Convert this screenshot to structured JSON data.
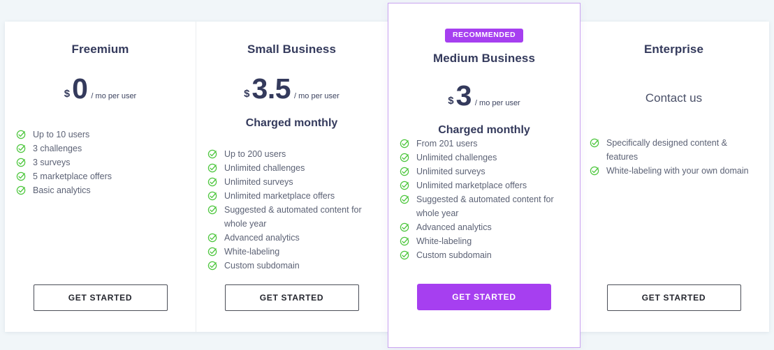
{
  "plans": [
    {
      "name": "Freemium",
      "currency": "$",
      "amount": "0",
      "period": "/ mo per user",
      "billing_note": "",
      "contact_label": "",
      "features": [
        "Up to 10 users",
        "3 challenges",
        "3 surveys",
        "5 marketplace offers",
        "Basic analytics"
      ],
      "cta_label": "GET STARTED"
    },
    {
      "name": "Small Business",
      "currency": "$",
      "amount": "3.5",
      "period": "/ mo per user",
      "billing_note": "Charged monthly",
      "contact_label": "",
      "features": [
        "Up to 200 users",
        "Unlimited challenges",
        "Unlimited surveys",
        "Unlimited marketplace offers",
        "Suggested & automated content for whole year",
        "Advanced analytics",
        "White-labeling",
        "Custom subdomain"
      ],
      "cta_label": "GET STARTED"
    },
    {
      "name": "Medium Business",
      "badge": "RECOMMENDED",
      "currency": "$",
      "amount": "3",
      "period": "/ mo per user",
      "billing_note": "Charged monthly",
      "contact_label": "",
      "features": [
        "From 201 users",
        "Unlimited challenges",
        "Unlimited surveys",
        "Unlimited marketplace offers",
        "Suggested & automated content for whole year",
        "Advanced analytics",
        "White-labeling",
        "Custom subdomain"
      ],
      "cta_label": "GET STARTED"
    },
    {
      "name": "Enterprise",
      "currency": "",
      "amount": "",
      "period": "",
      "billing_note": "",
      "contact_label": "Contact us",
      "features": [
        "Specifically designed content & features",
        "White-labeling with your own domain"
      ],
      "cta_label": "GET STARTED"
    }
  ],
  "icons": {
    "feature_check": "circle-check-icon"
  },
  "colors": {
    "accent_purple": "#a63ff0",
    "badge_purple": "#a63ff0",
    "featured_border": "#c9a3f0",
    "check_green": "#4cc63c",
    "heading_navy": "#343a5c",
    "feature_text": "#5c6275",
    "page_background": "#f1f6f9",
    "card_background": "#ffffff",
    "divider": "#ebeef0",
    "button_outline": "#4a4d57"
  }
}
